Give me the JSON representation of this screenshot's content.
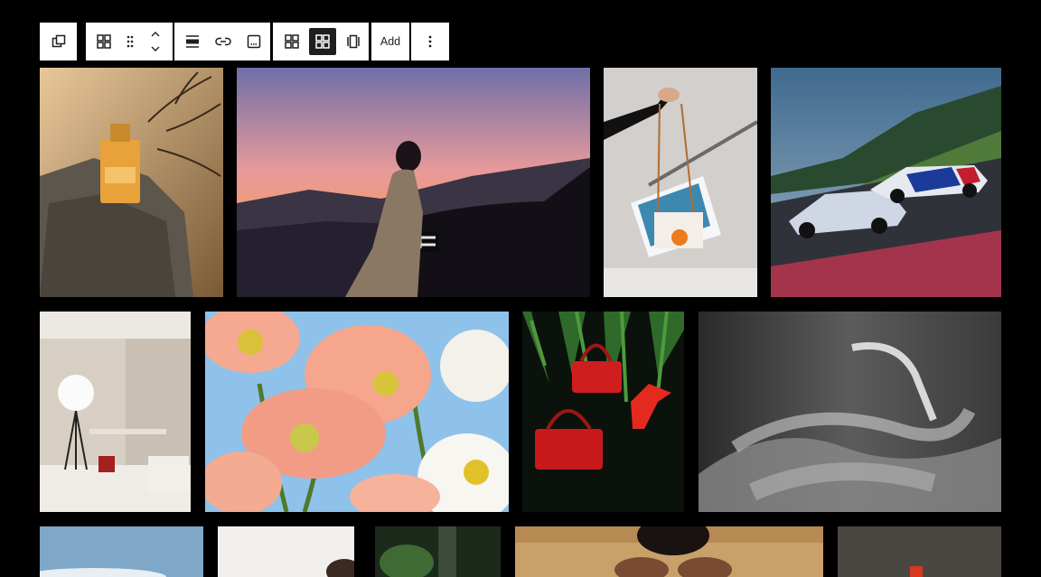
{
  "toolbar": {
    "add_label": "Add",
    "icons": [
      "duplicate-icon",
      "gallery-icon",
      "drag-handle-icon",
      "chevron-up-icon",
      "chevron-down-icon",
      "align-icon",
      "link-icon",
      "caption-icon",
      "grid-icon",
      "grid-active-icon",
      "carousel-icon",
      "more-options-icon"
    ]
  },
  "gallery": {
    "images": [
      "perfume-bottle-on-rock",
      "woman-leaning-on-car-at-sunset",
      "hand-holding-handbag",
      "race-cars-on-track",
      "photo-studio-interior",
      "pink-poppies-against-sky",
      "red-handbags-and-heels-in-ferns",
      "black-and-white-dancer",
      "sky-thumbnail",
      "portrait-thumbnail",
      "garden-thumbnail",
      "person-thumbnail",
      "room-thumbnail"
    ]
  },
  "colors": {
    "background": "#000000",
    "toolbar_bg": "#ffffff",
    "icon": "#1e1e1e",
    "active_bg": "#1e1e1e"
  }
}
